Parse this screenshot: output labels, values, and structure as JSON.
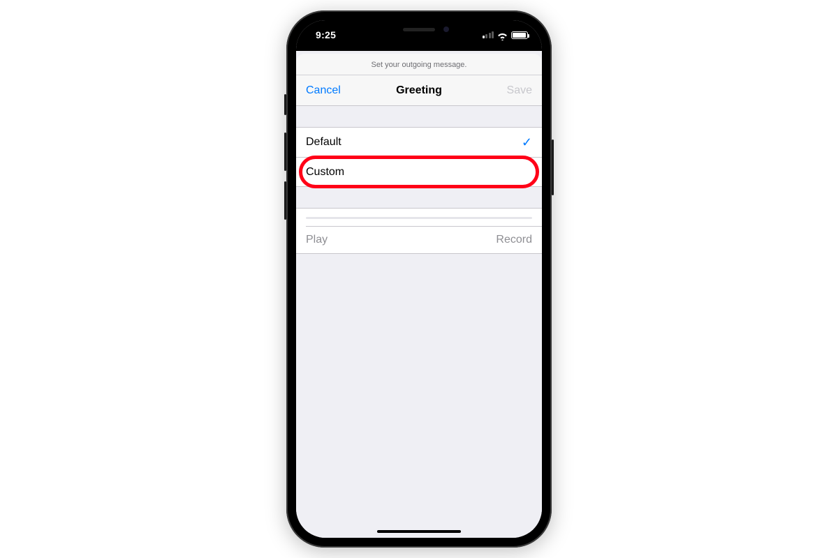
{
  "status_bar": {
    "time": "9:25"
  },
  "sheet": {
    "hint": "Set your outgoing message.",
    "title": "Greeting",
    "cancel": "Cancel",
    "save": "Save"
  },
  "options": {
    "default_label": "Default",
    "custom_label": "Custom",
    "selected": "default"
  },
  "controls": {
    "play": "Play",
    "record": "Record"
  },
  "annotation": {
    "highlighted_row": "custom"
  }
}
